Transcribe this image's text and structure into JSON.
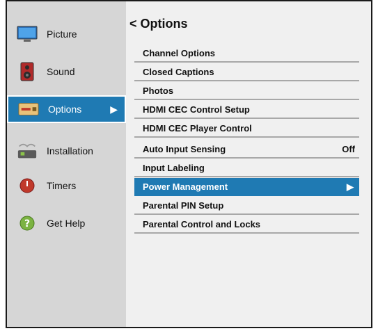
{
  "sidebar": {
    "items": [
      {
        "label": "Picture",
        "icon": "picture-icon"
      },
      {
        "label": "Sound",
        "icon": "speaker-icon"
      },
      {
        "label": "Options",
        "icon": "options-icon",
        "arrow": "▶"
      },
      {
        "label": "Installation",
        "icon": "installation-icon"
      },
      {
        "label": "Timers",
        "icon": "timer-icon"
      },
      {
        "label": "Get Help",
        "icon": "help-icon"
      }
    ]
  },
  "main": {
    "title": "< Options",
    "items": [
      {
        "label": "Channel Options"
      },
      {
        "label": "Closed Captions"
      },
      {
        "label": "Photos"
      },
      {
        "label": "HDMI CEC Control Setup"
      },
      {
        "label": "HDMI CEC Player Control"
      },
      {
        "label": "Auto Input Sensing",
        "value": "Off"
      },
      {
        "label": "Input Labeling"
      },
      {
        "label": "Power Management",
        "arrow": "▶"
      },
      {
        "label": "Parental PIN Setup"
      },
      {
        "label": "Parental Control and Locks"
      }
    ]
  },
  "colors": {
    "selected": "#1f7ab3",
    "sidebar": "#d6d6d6",
    "panel": "#f0f0f0"
  }
}
